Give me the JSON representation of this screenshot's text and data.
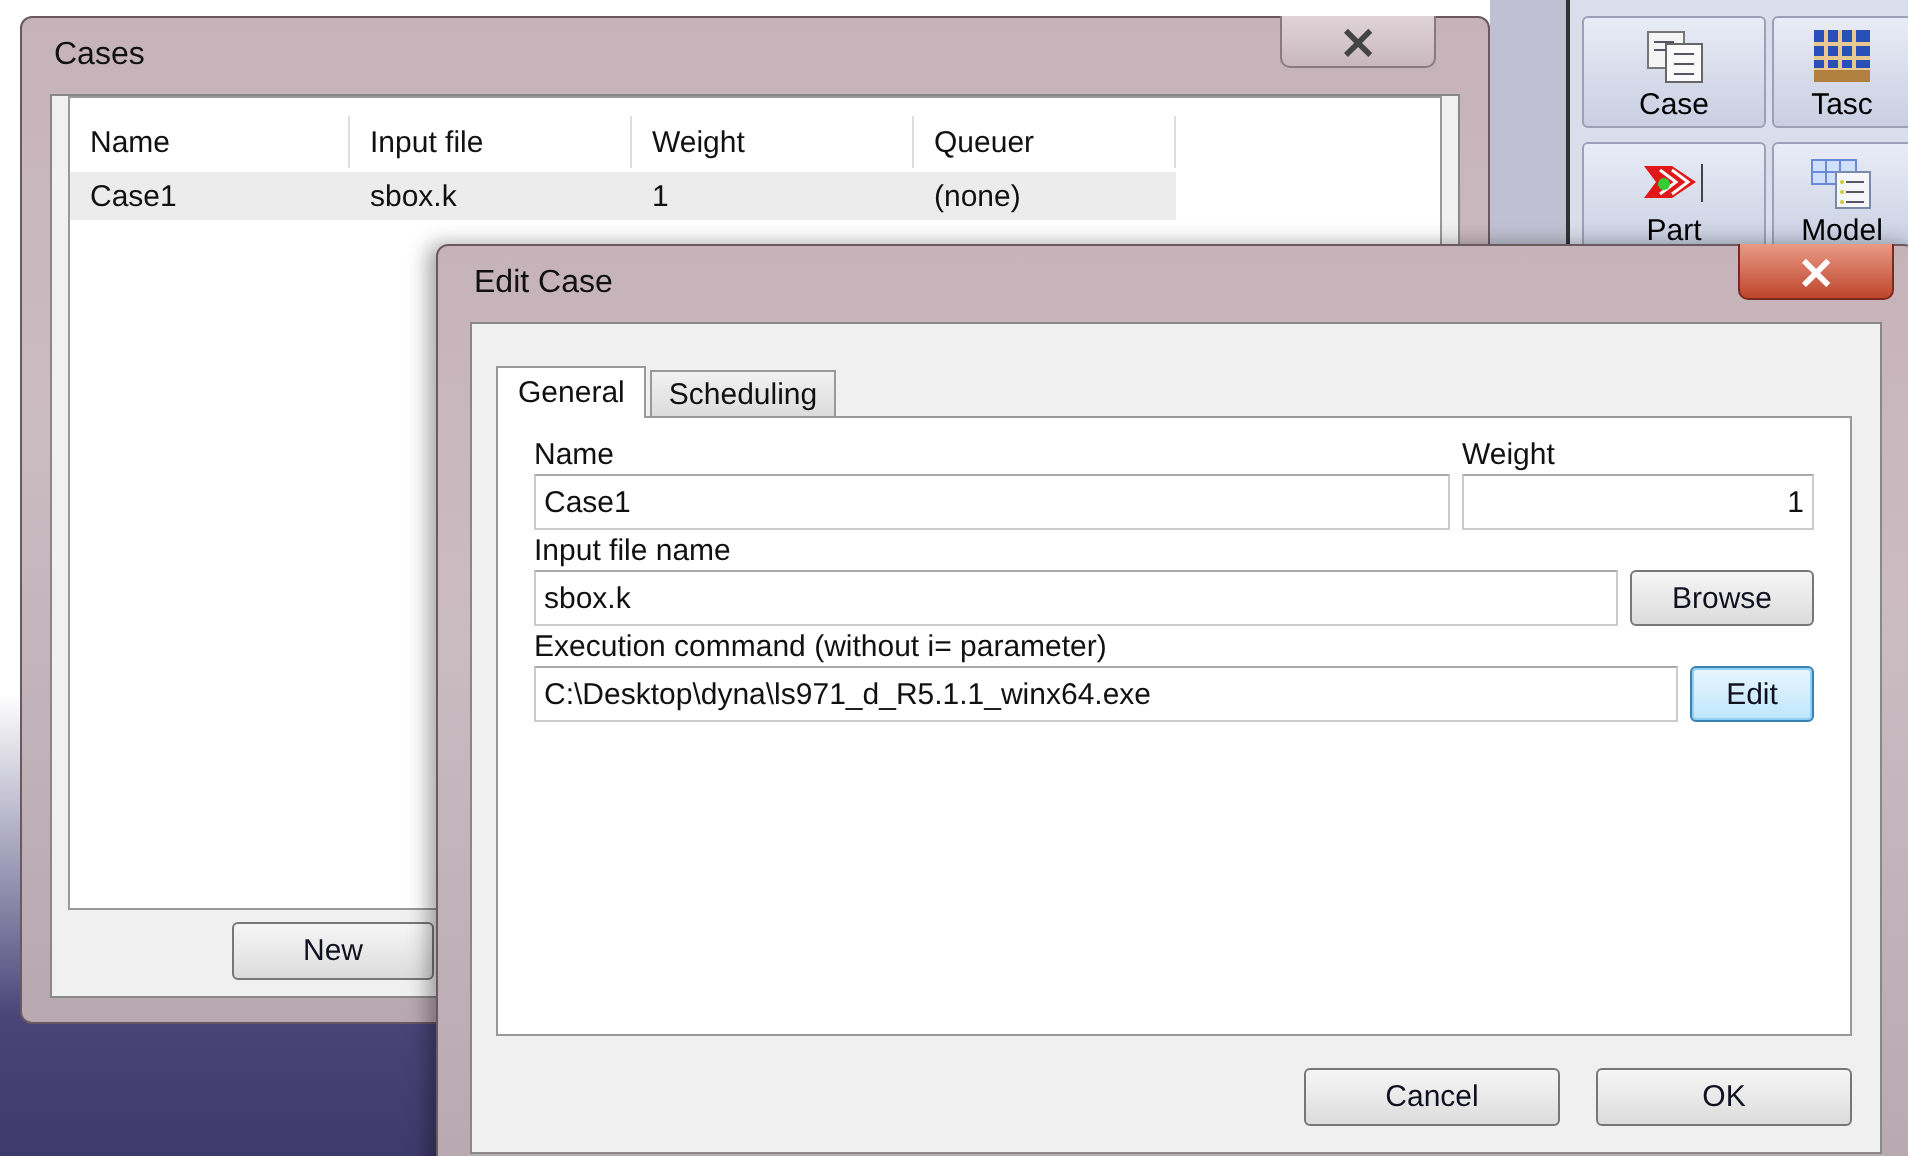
{
  "toolbar": {
    "items": [
      {
        "label": "Case",
        "kind": "case"
      },
      {
        "label": "Tasc",
        "kind": "tasc"
      },
      {
        "label": "Part",
        "kind": "part"
      },
      {
        "label": "Model",
        "kind": "model"
      }
    ]
  },
  "cases_window": {
    "title": "Cases",
    "close_symbol": "×",
    "columns": [
      "Name",
      "Input file",
      "Weight",
      "Queuer"
    ],
    "rows": [
      {
        "cells": [
          "Case1",
          "sbox.k",
          "1",
          "(none)"
        ],
        "selected": true
      }
    ],
    "buttons": [
      {
        "label": "New"
      }
    ]
  },
  "edit_window": {
    "title": "Edit Case",
    "close_symbol": "×",
    "tabs": [
      {
        "label": "General",
        "selected": true
      },
      {
        "label": "Scheduling",
        "selected": false
      }
    ],
    "form_rows": [
      {
        "fields": [
          {
            "label": "Name",
            "value": "Case1",
            "kind": "text"
          },
          {
            "label": "Weight",
            "value": "1",
            "kind": "numeric"
          }
        ]
      },
      {
        "fields": [
          {
            "label": "Input file name",
            "value": "sbox.k",
            "kind": "text"
          }
        ],
        "button": {
          "label": "Browse",
          "focused": false
        }
      },
      {
        "fields": [
          {
            "label": "Execution command (without i= parameter)",
            "value": "C:\\Desktop\\dyna\\ls971_d_R5.1.1_winx64.exe",
            "kind": "text"
          }
        ],
        "button": {
          "label": "Edit",
          "focused": true
        }
      }
    ],
    "buttons": [
      {
        "label": "Cancel"
      },
      {
        "label": "OK"
      }
    ]
  }
}
